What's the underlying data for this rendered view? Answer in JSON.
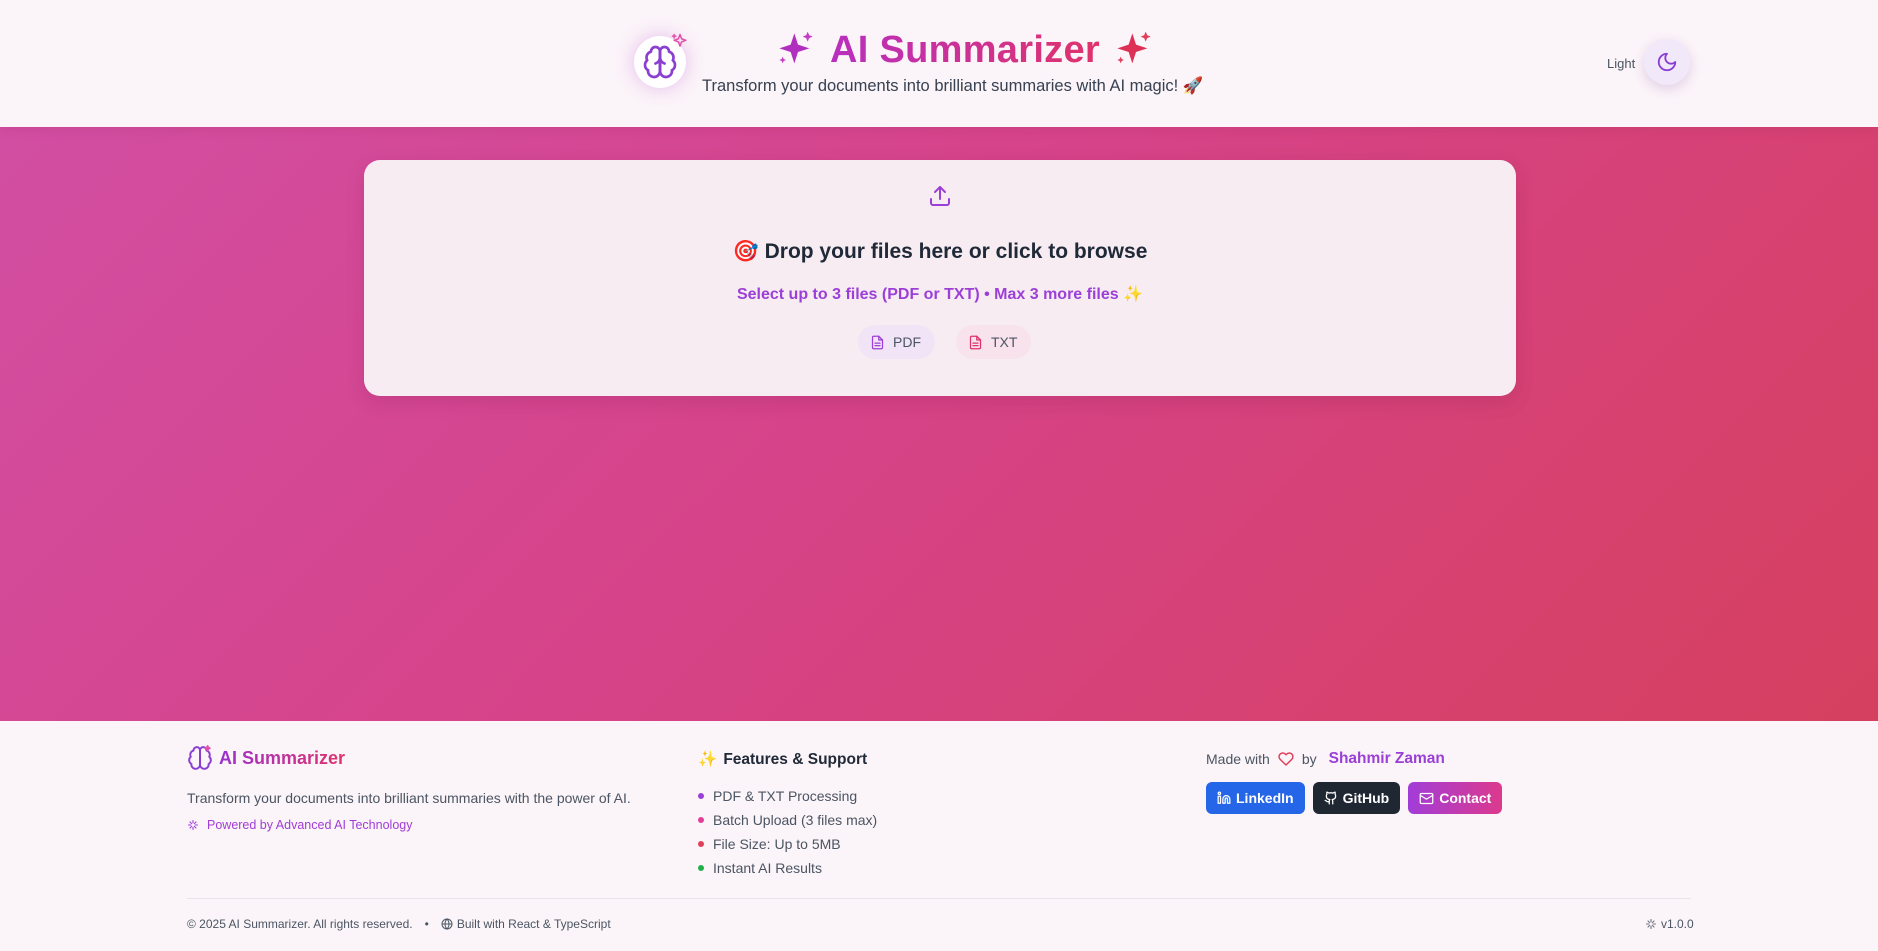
{
  "header": {
    "title": "AI Summarizer",
    "subtitle": "Transform your documents into brilliant summaries with AI magic! 🚀",
    "theme_label": "Light",
    "icons": [
      "brain-icon",
      "sparkles-icon",
      "moon-icon"
    ]
  },
  "upload": {
    "title": "🎯 Drop your files here or click to browse",
    "subtitle": "Select up to 3 files (PDF or TXT) • Max 3 more files ✨",
    "chips": [
      {
        "label": "PDF"
      },
      {
        "label": "TXT"
      }
    ]
  },
  "footer": {
    "brand": "AI Summarizer",
    "description": "Transform your documents into brilliant summaries with the power of AI.",
    "powered": "Powered by Advanced AI Technology",
    "features_title": "Features & Support",
    "features": [
      {
        "label": "PDF & TXT Processing",
        "color": "#9b3fd6"
      },
      {
        "label": "Batch Upload (3 files max)",
        "color": "#e0409a"
      },
      {
        "label": "File Size: Up to 5MB",
        "color": "#e0405a"
      },
      {
        "label": "Instant AI Results",
        "color": "#22b04b"
      }
    ],
    "made_with": "Made with",
    "by": "by",
    "author": "Shahmir Zaman",
    "buttons": {
      "linkedin": "LinkedIn",
      "github": "GitHub",
      "contact": "Contact"
    },
    "copyright": "© 2025 AI Summarizer. All rights reserved.",
    "separator": "•",
    "built_with": "Built with React & TypeScript",
    "version": "v1.0.0"
  },
  "colors": {
    "accent_purple": "#9b3fd6",
    "accent_pink": "#e0336a",
    "linkedin_blue": "#2566e8",
    "github_dark": "#1f2733"
  }
}
